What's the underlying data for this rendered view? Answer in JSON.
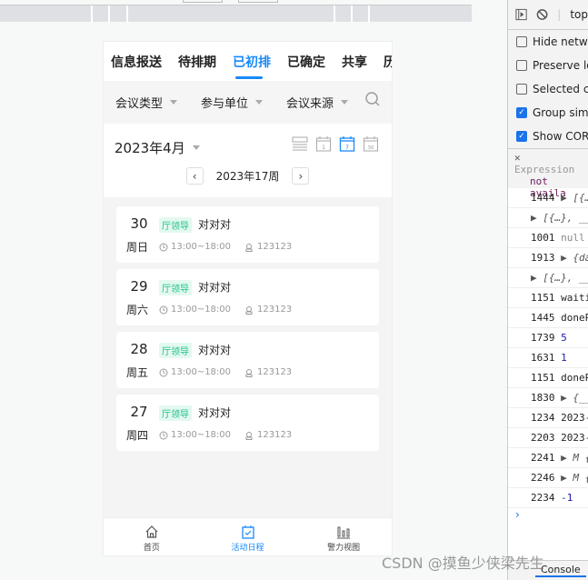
{
  "tabs": [
    "信息报送",
    "待排期",
    "已初排",
    "已确定",
    "共享",
    "历"
  ],
  "active_tab": 2,
  "filters": [
    "会议类型",
    "参与单位",
    "会议来源"
  ],
  "month": "2023年4月",
  "week": "2023年17周",
  "view_icons": [
    "list-view-icon",
    "day-view-icon",
    "week-view-icon",
    "month-view-icon"
  ],
  "view_icon_labels": {
    "day": "1",
    "week": "7",
    "month": "30"
  },
  "events": [
    {
      "day": "30",
      "weekday": "周日",
      "tag": "厅领导",
      "title": "对对对",
      "time": "13:00~18:00",
      "room": "123123"
    },
    {
      "day": "29",
      "weekday": "周六",
      "tag": "厅领导",
      "title": "对对对",
      "time": "13:00~18:00",
      "room": "123123"
    },
    {
      "day": "28",
      "weekday": "周五",
      "tag": "厅领导",
      "title": "对对对",
      "time": "13:00~18:00",
      "room": "123123"
    },
    {
      "day": "27",
      "weekday": "周四",
      "tag": "厅领导",
      "title": "对对对",
      "time": "13:00~18:00",
      "room": "123123"
    }
  ],
  "bottom_nav": [
    "首页",
    "活动日程",
    "警力视图"
  ],
  "accent": "#1989fa",
  "devtools": {
    "context": "top",
    "options": [
      {
        "label": "Hide netwo",
        "checked": false
      },
      {
        "label": "Preserve log",
        "checked": false
      },
      {
        "label": "Selected co",
        "checked": false
      },
      {
        "label": "Group simila",
        "checked": true
      },
      {
        "label": "Show CORS",
        "checked": true
      }
    ],
    "expression": "Expression",
    "expression_value": "not availa",
    "logs": [
      {
        "line": "1444",
        "val": "▶ [{…",
        "k": "o"
      },
      {
        "line": "",
        "val": "▶ [{…}, __",
        "k": "o"
      },
      {
        "line": "1001",
        "val": "null",
        "k": "n"
      },
      {
        "line": "1913",
        "val": "▶ {da",
        "k": "o"
      },
      {
        "line": "",
        "val": "▶ [{…}, __",
        "k": "o"
      },
      {
        "line": "1151",
        "val": "waiti",
        "k": ""
      },
      {
        "line": "1445",
        "val": "doneP",
        "k": ""
      },
      {
        "line": "1739",
        "val": "5",
        "k": "v"
      },
      {
        "line": "1631",
        "val": "1",
        "k": "v"
      },
      {
        "line": "1151",
        "val": "doneP",
        "k": ""
      },
      {
        "line": "1830",
        "val": "▶ {__",
        "k": "o"
      },
      {
        "line": "1234",
        "val": "2023-",
        "k": ""
      },
      {
        "line": "2203",
        "val": "2023-",
        "k": ""
      },
      {
        "line": "2241",
        "val": "▶ M {$L: '",
        "k": "o"
      },
      {
        "line": "2246",
        "val": "▶ M {$L: '",
        "k": "o"
      },
      {
        "line": "2234",
        "val": "-1",
        "k": "v"
      }
    ],
    "console_tab": "Console"
  },
  "watermark": "CSDN @摸鱼少侠梁先生"
}
